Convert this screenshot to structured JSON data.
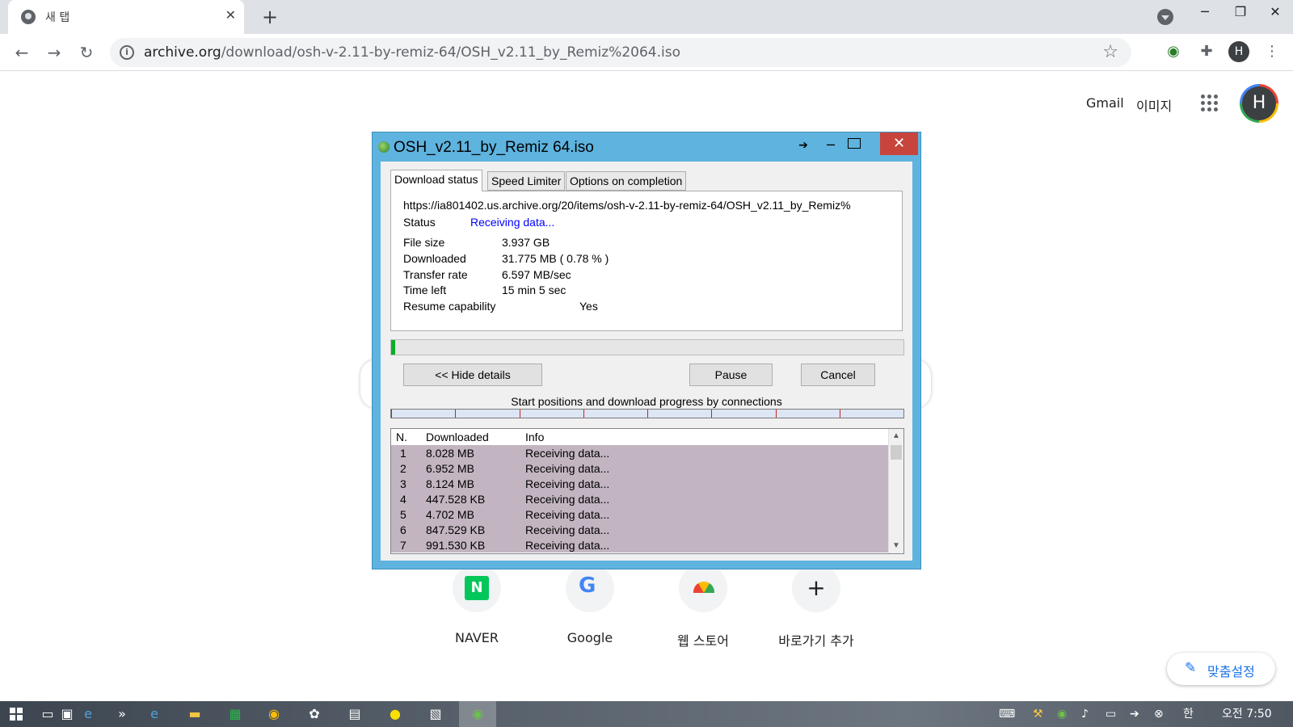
{
  "browser": {
    "tab_title": "새 탭",
    "tab_close": "✕",
    "new_tab": "+",
    "url_host": "archive.org",
    "url_path": "/download/osh-v-2.11-by-remiz-64/OSH_v2.11_by_Remiz%2064.iso",
    "profile_initial": "H"
  },
  "ntp": {
    "gmail": "Gmail",
    "images": "이미지",
    "account_initial": "H",
    "shortcuts": [
      {
        "label": "NAVER",
        "icon": "naver-icon",
        "glyph": "N"
      },
      {
        "label": "Google",
        "icon": "google-icon",
        "glyph": "G"
      },
      {
        "label": "웹 스토어",
        "icon": "web-store-icon"
      },
      {
        "label": "바로가기 추가",
        "icon": "add-shortcut-icon",
        "glyph": "+"
      }
    ],
    "customize": "맞춤설정"
  },
  "dialog": {
    "title": "OSH_v2.11_by_Remiz 64.iso",
    "tabs": [
      "Download status",
      "Speed Limiter",
      "Options on completion"
    ],
    "url": "https://ia801402.us.archive.org/20/items/osh-v-2.11-by-remiz-64/OSH_v2.11_by_Remiz%",
    "status_label": "Status",
    "status_value": "Receiving data...",
    "file_size_label": "File size",
    "file_size_value": "3.937  GB",
    "downloaded_label": "Downloaded",
    "downloaded_value": "31.775  MB  ( 0.78 % )",
    "transfer_rate_label": "Transfer rate",
    "transfer_rate_value": "6.597  MB/sec",
    "time_left_label": "Time left",
    "time_left_value": "15 min 5 sec",
    "resume_label": "Resume capability",
    "resume_value": "Yes",
    "progress_fraction": 0.0078,
    "buttons": {
      "hide": "<< Hide details",
      "pause": "Pause",
      "cancel": "Cancel"
    },
    "connections_label": "Start positions and download progress by connections",
    "connection_count": 8,
    "table_headers": [
      "N.",
      "Downloaded",
      "Info"
    ],
    "connections": [
      {
        "n": "1",
        "downloaded": "8.028  MB",
        "info": "Receiving data..."
      },
      {
        "n": "2",
        "downloaded": "6.952  MB",
        "info": "Receiving data..."
      },
      {
        "n": "3",
        "downloaded": "8.124  MB",
        "info": "Receiving data..."
      },
      {
        "n": "4",
        "downloaded": "447.528  KB",
        "info": "Receiving data..."
      },
      {
        "n": "5",
        "downloaded": "4.702  MB",
        "info": "Receiving data..."
      },
      {
        "n": "6",
        "downloaded": "847.529  KB",
        "info": "Receiving data..."
      },
      {
        "n": "7",
        "downloaded": "991.530  KB",
        "info": "Receiving data..."
      }
    ]
  },
  "taskbar": {
    "clock": "오전 7:50",
    "ime": "한",
    "overflow": "»"
  },
  "colors": {
    "dialog_frame": "#5eb3df",
    "dialog_close": "#c7453c",
    "connection_row": "#c2b5c1",
    "status_blue": "#0000ff",
    "accent_blue": "#1a73e8"
  }
}
